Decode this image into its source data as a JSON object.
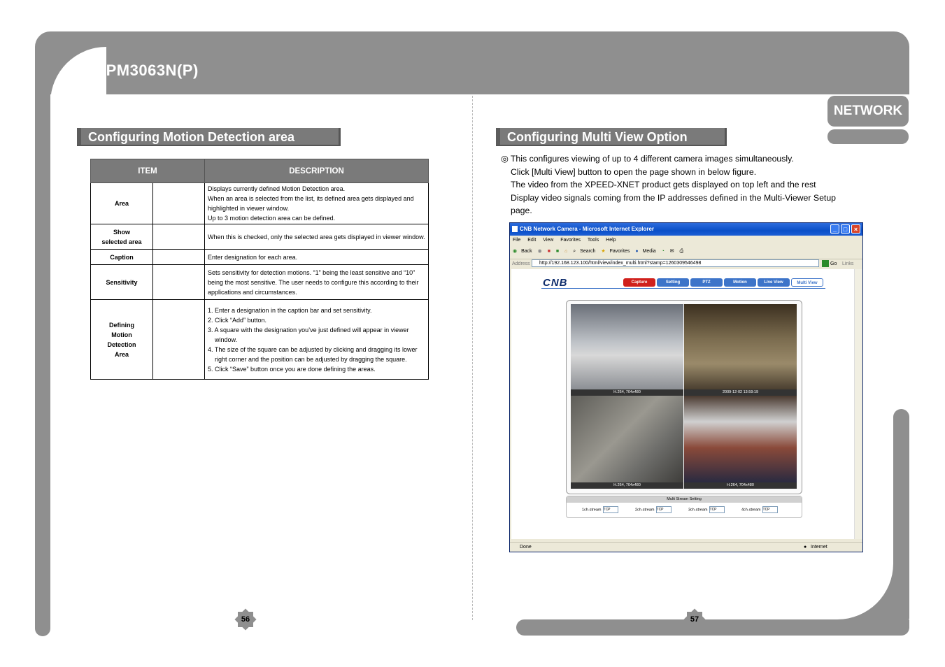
{
  "header": {
    "product": "IPM3063N(P)",
    "section_tab": "NETWORK"
  },
  "left": {
    "title": "Configuring Motion Detection area",
    "table": {
      "headers": [
        "ITEM",
        "DESCRIPTION"
      ],
      "rows": [
        {
          "item": "Area",
          "lines": [
            "Displays currently defined Motion Detection area.",
            "When an area is selected from the list, its defined area gets displayed and highlighted in viewer window.",
            "Up to 3 motion detection area can be defined."
          ]
        },
        {
          "item_lines": [
            "Show",
            "selected area"
          ],
          "lines": [
            "When this is checked, only the selected area gets displayed in viewer window."
          ]
        },
        {
          "item": "Caption",
          "lines": [
            "Enter designation for each area."
          ]
        },
        {
          "item": "Sensitivity",
          "lines": [
            "Sets sensitivity for detection motions. “1” being the least sensitive and “10” being the most sensitive. The user needs to configure this according to their applications and circumstances."
          ]
        },
        {
          "item_lines": [
            "Defining",
            "Motion",
            "Detection",
            "Area"
          ],
          "lines": [
            "1. Enter a designation in the caption bar and set sensitivity.",
            "2. Click “Add” button.",
            "3. A square with the designation you’ve just defined will appear in viewer window.",
            "4. The size of the square can be adjusted by clicking and dragging its lower right corner and the position can be adjusted by dragging the square.",
            "5. Click “Save” button once you are done defining the areas."
          ]
        }
      ]
    },
    "page_number": "56"
  },
  "right": {
    "title": "Configuring Multi View Option",
    "paragraph": [
      "◎ This configures viewing of up to 4 different camera images simultaneously.",
      "Click [Multi View] button to open the page shown in below figure.",
      "The video from the XPEED-XNET product gets displayed on top left and the rest",
      "Display video signals coming from the IP addresses defined in the Multi-Viewer Setup",
      "page."
    ],
    "page_number": "57",
    "browser": {
      "title": "CNB Network Camera - Microsoft Internet Explorer",
      "menu": [
        "File",
        "Edit",
        "View",
        "Favorites",
        "Tools",
        "Help"
      ],
      "toolbar": [
        "Back",
        "Search",
        "Favorites",
        "Media"
      ],
      "address_label": "Address",
      "address": "http://192.168.123.100/html/view/index_multi.html?stamp=1260309546498",
      "go": "Go",
      "links": "Links",
      "logo": "CNB",
      "nav": [
        "Capture",
        "Setting",
        "PTZ",
        "Motion",
        "Live View",
        "Multi View"
      ],
      "captions": [
        "H.264, 704x480",
        "2009-12-02 13:59:19",
        "H.264, 704x480",
        "H.264, 704x480"
      ],
      "multi_stream_title": "Multi Stream Setting",
      "streams": [
        {
          "label": "1ch-stream",
          "value": "TCP"
        },
        {
          "label": "2ch-stream",
          "value": "TCP"
        },
        {
          "label": "3ch-stream",
          "value": "TCP"
        },
        {
          "label": "4ch-stream",
          "value": "TCP"
        }
      ],
      "status_left": "Done",
      "status_right": "Internet",
      "colors": {
        "capture": "#d0201c",
        "nav": "#3d74c9"
      }
    }
  }
}
